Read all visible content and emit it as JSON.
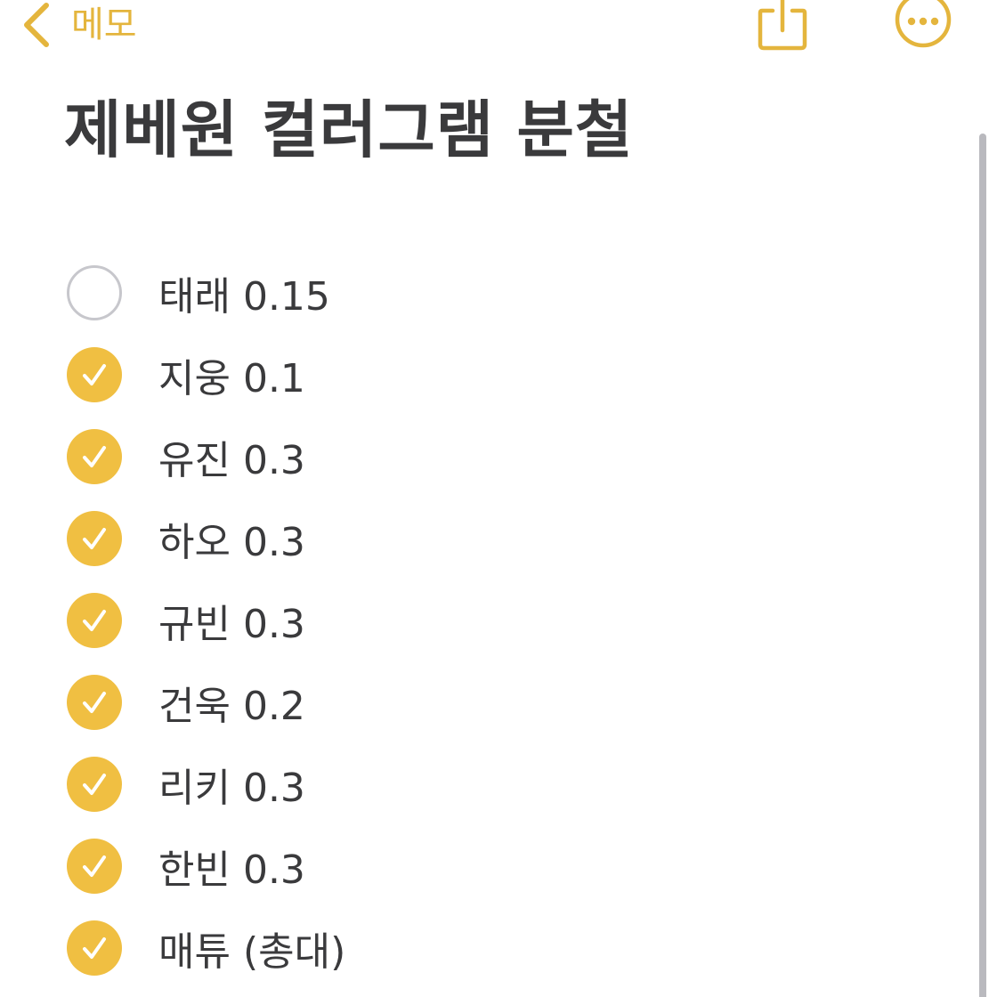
{
  "nav": {
    "back_label": "메모"
  },
  "note": {
    "title": "제베원 컬러그램 분철"
  },
  "checklist": [
    {
      "text": "태래 0.15",
      "checked": false
    },
    {
      "text": "지웅 0.1",
      "checked": true
    },
    {
      "text": "유진 0.3",
      "checked": true
    },
    {
      "text": "하오 0.3",
      "checked": true
    },
    {
      "text": "규빈 0.3",
      "checked": true
    },
    {
      "text": "건욱 0.2",
      "checked": true
    },
    {
      "text": "리키 0.3",
      "checked": true
    },
    {
      "text": "한빈 0.3",
      "checked": true
    },
    {
      "text": "매튜 (총대)",
      "checked": true
    }
  ],
  "icons": {
    "back": "chevron-left-icon",
    "share": "share-icon",
    "more": "more-ellipsis-icon",
    "checked": "checkmark-circle-filled-icon",
    "unchecked": "empty-circle-icon"
  },
  "colors": {
    "accent": "#e4b53d",
    "text": "#3a3a3c",
    "unchecked_border": "#c7c7cc",
    "background": "#ffffff"
  }
}
